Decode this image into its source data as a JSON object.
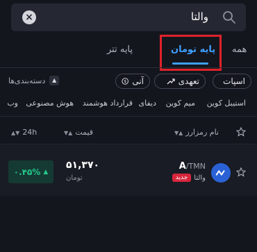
{
  "search": {
    "query": "والتا"
  },
  "tabs": [
    {
      "label": "همه",
      "active": false
    },
    {
      "label": "پایه تومان",
      "active": true
    },
    {
      "label": "پایه تتر",
      "active": false
    }
  ],
  "filters": {
    "chips": [
      {
        "label": "اسپات",
        "icon": "spot-chart-icon"
      },
      {
        "label": "تعهدی",
        "icon": "margin-trend-icon"
      },
      {
        "label": "آنی",
        "icon": "instant-dollar-icon"
      }
    ],
    "categories_toggle": "دسته‌بندی‌ها"
  },
  "categories": [
    "استیبل کوین",
    "میم کوین",
    "دیفای",
    "قرارداد هوشمند",
    "هوش مصنوعی",
    "وب"
  ],
  "table": {
    "headers": {
      "name": "نام رمزارز",
      "price": "قیمت",
      "change": "24h"
    },
    "rows": [
      {
        "symbol": "A",
        "quote": "/TMN",
        "name": "والتا",
        "badge": "جدید",
        "price": "۵۱,۳۷۰",
        "price_unit": "تومان",
        "change": "۰.۴۵%",
        "direction": "up"
      }
    ]
  },
  "colors": {
    "accent": "#3ea0ff",
    "positive": "#25c58a",
    "badge": "#d7263d",
    "highlight_box": "#e0222a"
  }
}
